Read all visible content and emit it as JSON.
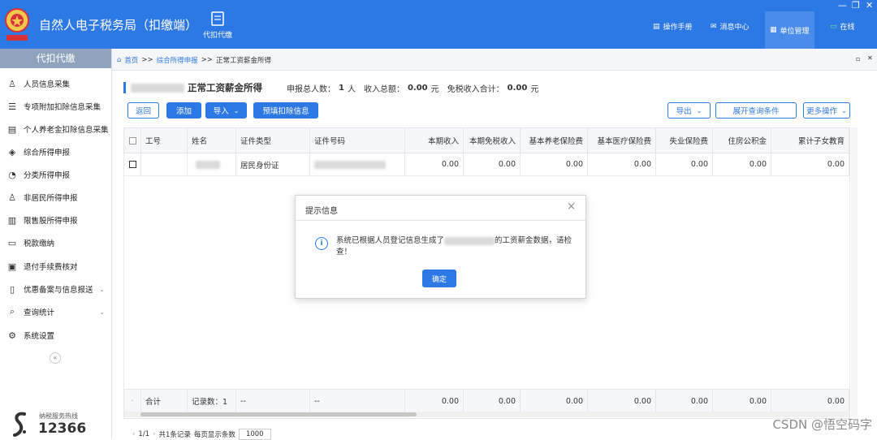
{
  "app": {
    "title": "自然人电子税务局（扣缴端）"
  },
  "topnav": {
    "tab_label": "代扣代缴"
  },
  "header": {
    "manual": "操作手册",
    "messages": "消息中心",
    "unit": "单位管理",
    "online": "在线"
  },
  "sidebar": {
    "heading": "代扣代缴",
    "items": [
      {
        "label": "人员信息采集",
        "icon": "person-icon"
      },
      {
        "label": "专项附加扣除信息采集",
        "icon": "list-icon"
      },
      {
        "label": "个人养老金扣除信息采集",
        "icon": "pension-icon"
      },
      {
        "label": "综合所得申报",
        "icon": "layers-icon"
      },
      {
        "label": "分类所得申报",
        "icon": "pie-icon"
      },
      {
        "label": "非居民所得申报",
        "icon": "person-outline-icon"
      },
      {
        "label": "限售股所得申报",
        "icon": "bar-chart-icon"
      },
      {
        "label": "税款缴纳",
        "icon": "folder-icon"
      },
      {
        "label": "退付手续费核对",
        "icon": "doc-check-icon"
      },
      {
        "label": "优惠备案与信息报送",
        "icon": "file-icon",
        "expandable": true
      },
      {
        "label": "查询统计",
        "icon": "search-list-icon",
        "expandable": true
      },
      {
        "label": "系统设置",
        "icon": "gear-icon"
      }
    ],
    "hotline_label": "纳税服务热线",
    "hotline_number": "12366"
  },
  "breadcrumb": {
    "home": "首页",
    "sep": ">>",
    "level2": "综合所得申报",
    "current": "正常工资薪金所得"
  },
  "summary": {
    "title": "正常工资薪金所得",
    "total_people_label": "申报总人数：",
    "total_people": "1",
    "people_unit": "人",
    "income_label": "收入总额：",
    "income": "0.00",
    "income_unit": "元",
    "exempt_label": "免税收入合计：",
    "exempt": "0.00"
  },
  "toolbar": {
    "back": "返回",
    "add": "添加",
    "import": "导入",
    "prefill": "预填扣除信息",
    "export": "导出",
    "expand_query": "展开查询条件",
    "more": "更多操作"
  },
  "table": {
    "headers": [
      "工号",
      "姓名",
      "证件类型",
      "证件号码",
      "本期收入",
      "本期免税收入",
      "基本养老保险费",
      "基本医疗保险费",
      "失业保险费",
      "住房公积金",
      "累计子女教育"
    ],
    "rows": [
      {
        "id_type": "居民身份证",
        "cells": [
          "0.00",
          "0.00",
          "0.00",
          "0.00",
          "0.00",
          "0.00",
          "0.00"
        ]
      }
    ],
    "footer": {
      "total_label": "合计",
      "record_label": "记录数：1",
      "dash1": "--",
      "dash2": "--",
      "cells": [
        "0.00",
        "0.00",
        "0.00",
        "0.00",
        "0.00",
        "0.00",
        "0.00"
      ]
    }
  },
  "pager": {
    "page": "1/1",
    "total": "共1条记录",
    "per_page_label": "每页显示条数",
    "per_page": "1000"
  },
  "dialog": {
    "title": "提示信息",
    "message_prefix": "系统已根据人员登记信息生成了",
    "message_suffix": "的工资薪金数据，请检查！",
    "ok": "确定"
  },
  "watermark": "CSDN @悟空码字",
  "colors": {
    "brand": "#2c78e4",
    "sidebar_head": "#8fa3bd"
  }
}
